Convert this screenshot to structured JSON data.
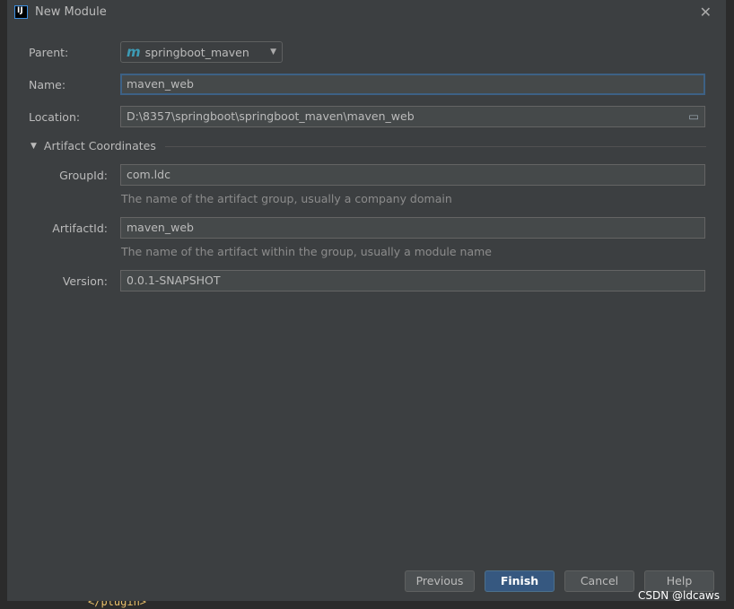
{
  "title": "New Module",
  "parent": {
    "label": "Parent:",
    "value": "springboot_maven"
  },
  "name": {
    "label": "Name:",
    "value": "maven_web"
  },
  "location": {
    "label": "Location:",
    "value": "D:\\8357\\springboot\\springboot_maven\\maven_web"
  },
  "artifact_section": "Artifact Coordinates",
  "group": {
    "label": "GroupId:",
    "value": "com.ldc",
    "hint": "The name of the artifact group, usually a company domain"
  },
  "artifact": {
    "label": "ArtifactId:",
    "value": "maven_web",
    "hint": "The name of the artifact within the group, usually a module name"
  },
  "version": {
    "label": "Version:",
    "value": "0.0.1-SNAPSHOT"
  },
  "buttons": {
    "previous": "Previous",
    "finish": "Finish",
    "cancel": "Cancel",
    "help": "Help"
  },
  "background_code": "</plugin>",
  "watermark": "CSDN @ldcaws",
  "colors": {
    "accent": "#365880",
    "focus": "#3d6185"
  }
}
